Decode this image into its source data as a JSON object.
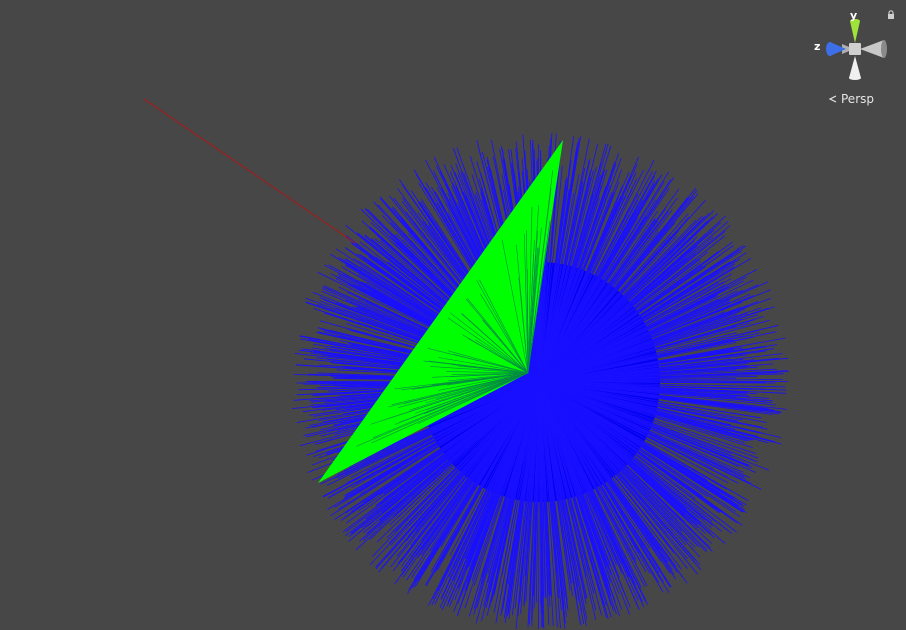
{
  "scene": {
    "background_color": "#474747",
    "ray_color": "#1a10ff",
    "ray_core_color": "#0000ee",
    "triangle_color": "#00ff00",
    "triangle_ray_color": "#008c44",
    "line_color": "#9b1f1f"
  },
  "gizmo": {
    "axes": {
      "y": "y",
      "z": "z"
    },
    "colors": {
      "y": "#9ee23a",
      "z": "#3d6fe8",
      "x": "#c8c8c8",
      "neg": "#b0b0b0",
      "center": "#d0d0d0"
    },
    "lock_icon": "lock-icon"
  },
  "projection": {
    "label": "Persp",
    "icon": "chevron-left-icon"
  }
}
